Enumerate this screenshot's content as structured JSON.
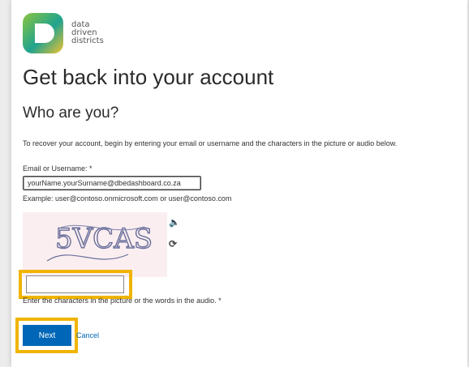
{
  "brand": {
    "logo_lines": [
      "data",
      "driven",
      "districts"
    ],
    "colors": {
      "green": "#7cc242",
      "teal": "#1f9f8f",
      "yellow": "#f2c230"
    }
  },
  "page": {
    "title": "Get back into your account",
    "subtitle": "Who are you?",
    "intro": "To recover your account, begin by entering your email or username and the characters in the picture or audio below."
  },
  "form": {
    "email_label": "Email or Username: *",
    "email_value": "yourName.yourSurname@dbedashboard.co.za",
    "email_example": "Example: user@contoso.onmicrosoft.com or user@contoso.com",
    "captcha_text": "5VCAS",
    "captcha_audio_icon": "speaker-icon",
    "captcha_refresh_icon": "refresh-icon",
    "captcha_value": "",
    "captcha_hint": "Enter the characters in the picture or the words in the audio. *"
  },
  "actions": {
    "next_label": "Next",
    "cancel_label": "Cancel"
  },
  "highlight_color": "#f0b400",
  "primary_color": "#0067b8"
}
